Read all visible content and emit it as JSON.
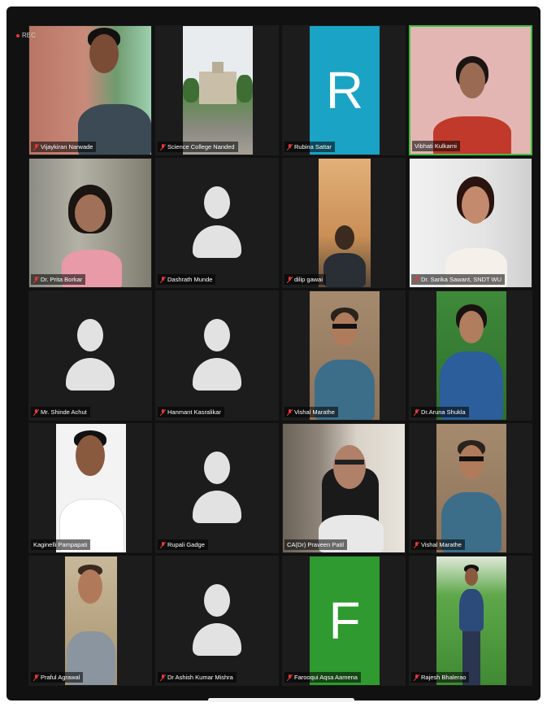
{
  "recording": {
    "label": "REC"
  },
  "participants": [
    {
      "name": "Vijaykiran Narwade"
    },
    {
      "name": "Science College Nanded"
    },
    {
      "name": "Rubina Sattar",
      "initial": "R"
    },
    {
      "name": "Vibhati Kulkarni"
    },
    {
      "name": "Dr. Prita Borkar"
    },
    {
      "name": "Dashrath Munde"
    },
    {
      "name": "dilip gawai"
    },
    {
      "name": "Dr. Sarika Sawant, SNDT WU"
    },
    {
      "name": "Mr. Shinde Achut"
    },
    {
      "name": "Hanmant Kasralikar"
    },
    {
      "name": "Vishal Marathe"
    },
    {
      "name": "Dr.Aruna Shukla"
    },
    {
      "name": "Kaginelli Pampapati"
    },
    {
      "name": "Rupali Gadge"
    },
    {
      "name": "CA(Dr) Praveen Patil"
    },
    {
      "name": "Vishal Marathe"
    },
    {
      "name": "Praful Agrawal"
    },
    {
      "name": "Dr Ashish Kumar Mishra"
    },
    {
      "name": "Farooqui Aqsa Aamena",
      "initial": "F"
    },
    {
      "name": "Rajesh Bhalerao"
    }
  ],
  "colors": {
    "letter_tile_blue": "#1aa3c4",
    "letter_tile_green": "#2f9a2f",
    "active_speaker_border": "#3fbf3f",
    "muted_mic": "#e53935"
  }
}
